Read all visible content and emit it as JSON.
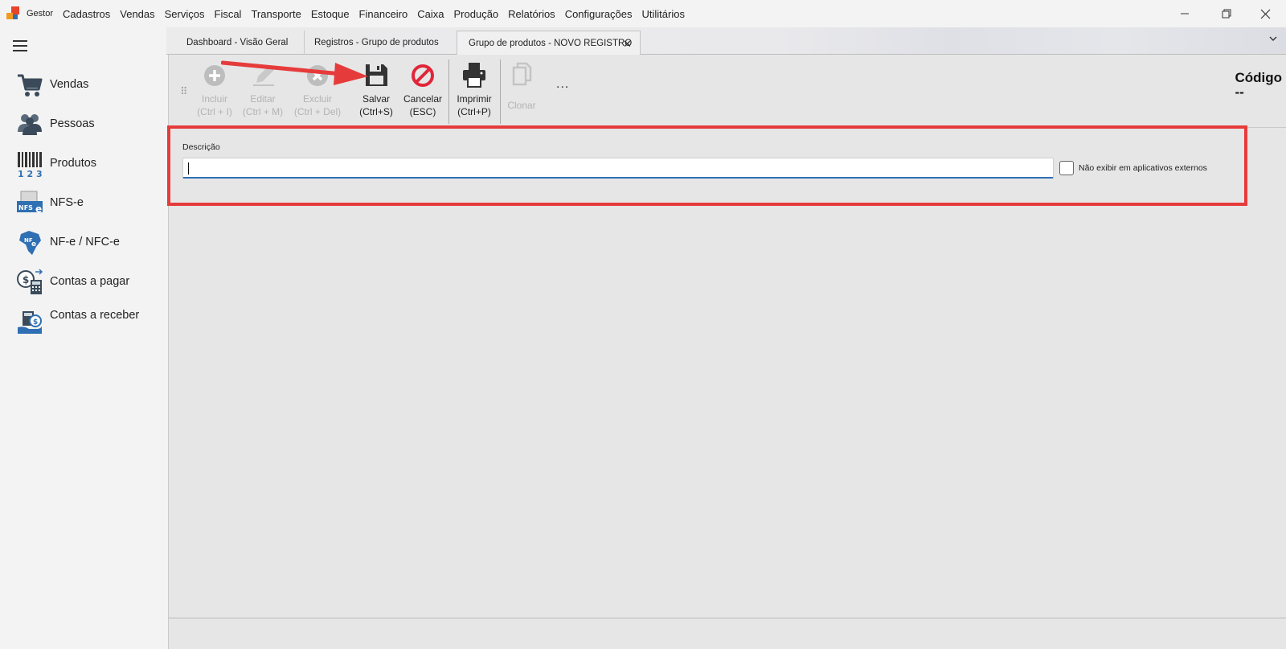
{
  "menu": {
    "items": [
      "Gestor",
      "Cadastros",
      "Vendas",
      "Serviços",
      "Fiscal",
      "Transporte",
      "Estoque",
      "Financeiro",
      "Caixa",
      "Produção",
      "Relatórios",
      "Configurações",
      "Utilitários"
    ]
  },
  "window_controls": {
    "minimize": "—",
    "restore": "❐",
    "close": "✕"
  },
  "sidebar": {
    "items": [
      {
        "label": "Vendas",
        "icon": "shopping-cart-icon"
      },
      {
        "label": "Pessoas",
        "icon": "people-icon"
      },
      {
        "label": "Produtos",
        "icon": "barcode-icon"
      },
      {
        "label": "NFS-e",
        "icon": "nfse-icon"
      },
      {
        "label": "NF-e / NFC-e",
        "icon": "nfe-map-icon"
      },
      {
        "label": "Contas a pagar",
        "icon": "calculator-money-icon"
      },
      {
        "label": "Contas a receber",
        "icon": "receive-money-icon"
      }
    ]
  },
  "tabs": [
    {
      "label": "Dashboard - Visão Geral",
      "active": false
    },
    {
      "label": "Registros - Grupo de produtos",
      "active": false
    },
    {
      "label": "Grupo de produtos - NOVO REGISTRO",
      "active": true,
      "close": "✕"
    }
  ],
  "tabs_overflow": "⌄",
  "toolbar": {
    "buttons": [
      {
        "label": "Incluir",
        "shortcut": "(Ctrl + I)",
        "icon": "plus-circle-icon",
        "enabled": false
      },
      {
        "label": "Editar",
        "shortcut": "(Ctrl + M)",
        "icon": "pencil-icon",
        "enabled": false
      },
      {
        "label": "Excluir",
        "shortcut": "(Ctrl + Del)",
        "icon": "x-circle-icon",
        "enabled": false
      },
      {
        "label": "Salvar",
        "shortcut": "(Ctrl+S)",
        "icon": "floppy-disk-icon",
        "enabled": true
      },
      {
        "label": "Cancelar",
        "shortcut": "(ESC)",
        "icon": "cancel-icon",
        "enabled": true
      },
      {
        "label": "Imprimir",
        "shortcut": "(Ctrl+P)",
        "icon": "printer-icon",
        "enabled": true
      },
      {
        "label": "Clonar",
        "shortcut": "",
        "icon": "copy-icon",
        "enabled": false
      }
    ],
    "more": "...",
    "grip": "⠿"
  },
  "header": {
    "codigo_label": "Código",
    "codigo_value": "--"
  },
  "form": {
    "descricao_label": "Descrição",
    "descricao_value": "",
    "nao_exibir_label": "Não exibir em aplicativos externos",
    "nao_exibir_checked": false
  },
  "colors": {
    "annotation": "#e63b3b",
    "focus": "#2f6fb3",
    "cancel": "#e0263a"
  }
}
